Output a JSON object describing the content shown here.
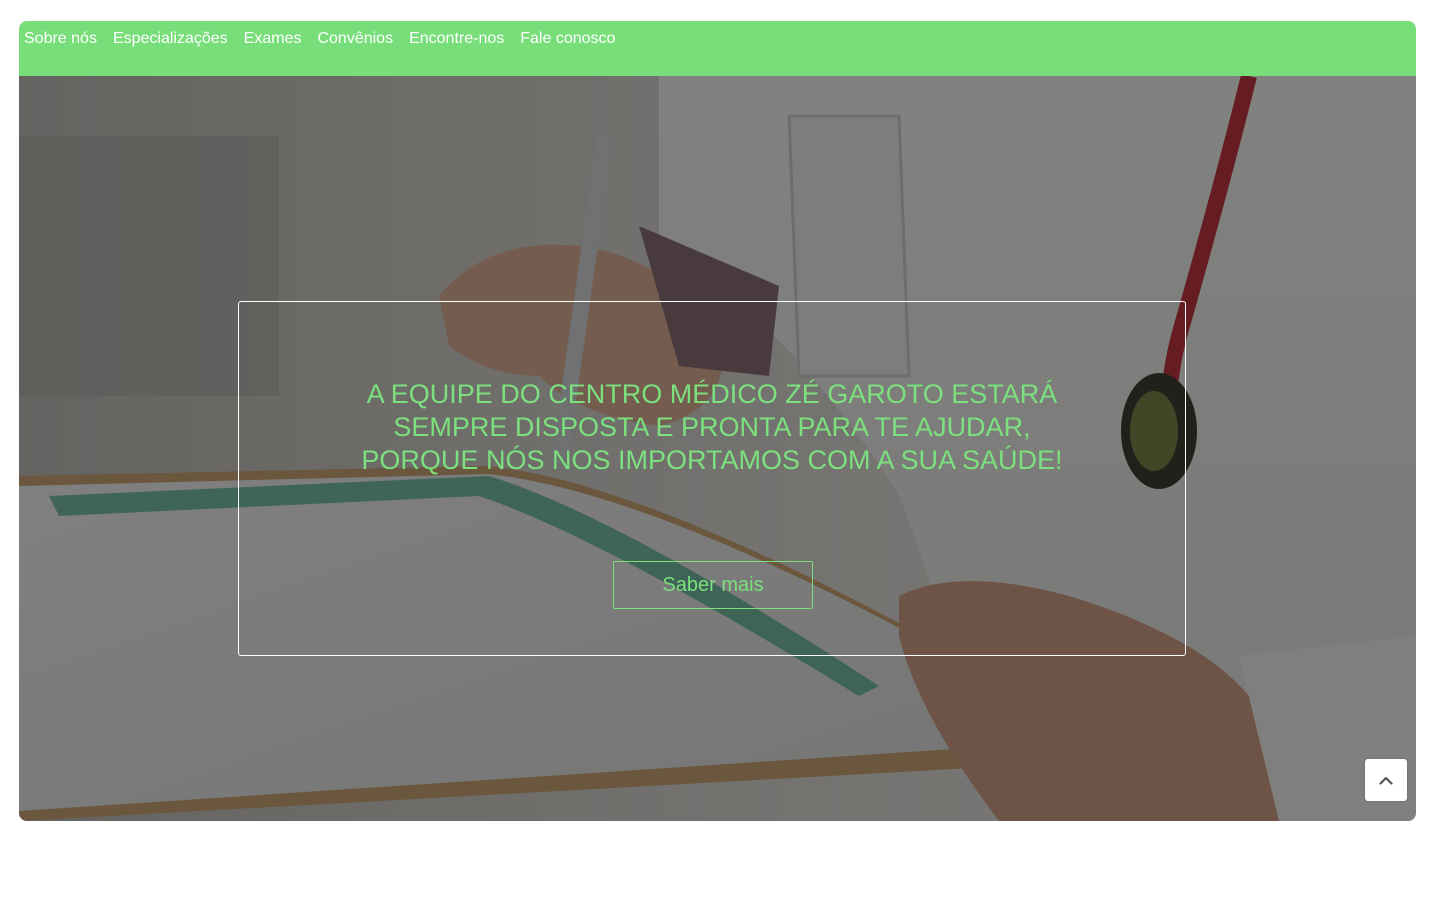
{
  "nav": {
    "items": [
      {
        "label": "Sobre nós"
      },
      {
        "label": "Especializações"
      },
      {
        "label": "Exames"
      },
      {
        "label": "Convênios"
      },
      {
        "label": "Encontre-nos"
      },
      {
        "label": "Fale conosco"
      }
    ]
  },
  "hero": {
    "headline_lines": [
      "A EQUIPE DO CENTRO MÉDICO ZÉ GAROTO ESTARÁ",
      "SEMPRE DISPOSTA E PRONTA PARA TE AJUDAR,",
      "PORQUE NÓS NOS IMPORTAMOS COM A SUA SAÚDE!"
    ],
    "cta_label": "Saber mais",
    "background_image": "doctor writing on clipboard with stethoscope"
  },
  "scroll_top": {
    "icon": "chevron-up-icon"
  },
  "colors": {
    "accent_green": "#78de79",
    "text_green": "#7be07d",
    "white": "#ffffff"
  }
}
